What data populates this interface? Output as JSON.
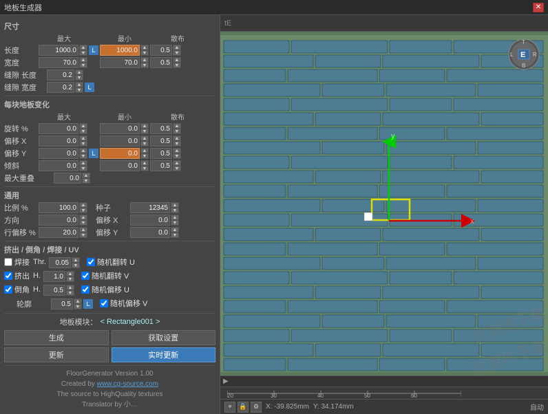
{
  "titleBar": {
    "title": "地板生成器",
    "closeIcon": "✕"
  },
  "leftPanel": {
    "sectionSize": "尺寸",
    "headers": {
      "max": "最大",
      "min": "最小",
      "scatter": "散布"
    },
    "lengthLabel": "长度",
    "lengthMax": "1000.0",
    "lengthMin": "1000.0",
    "lengthScatter": "0.5",
    "widthLabel": "宽度",
    "widthMax": "70.0",
    "widthMin": "70.0",
    "widthScatter": "0.5",
    "gapLengthLabel": "缝隙 长度",
    "gapLength": "0.2",
    "gapWidthLabel": "缝隙 宽度",
    "gapWidth": "0.2",
    "sectionTile": "每块地板变化",
    "rotateLabel": "旋转 %",
    "rotateMax": "0.0",
    "rotateMin": "0.0",
    "rotateScatter": "0.5",
    "offsetXLabel": "偏移 X",
    "offsetXMax": "0.0",
    "offsetXMin": "0.0",
    "offsetXScatter": "0.5",
    "offsetYLabel": "偏移 Y",
    "offsetYMax": "0.0",
    "offsetYMin": "0.0",
    "offsetYScatter": "0.5",
    "tiltLabel": "倾斜",
    "tiltMax": "0.0",
    "tiltMin": "0.0",
    "tiltScatter": "0.5",
    "maxOverlapLabel": "最大重叠",
    "maxOverlap": "0.0",
    "sectionGeneral": "通用",
    "scaleLabel": "比例 %",
    "scaleValue": "100.0",
    "seedLabel": "种子",
    "seedValue": "12345",
    "directionLabel": "方向",
    "directionValue": "0.0",
    "offsetXGenLabel": "偏移 X",
    "offsetXGenValue": "0.0",
    "rowOffsetLabel": "行偏移 %",
    "rowOffsetValue": "20.0",
    "offsetYGenLabel": "偏移 Y",
    "offsetYGenValue": "0.0",
    "sectionExtrude": "挤出 / 倒角 / 焊接 / UV",
    "weldLabel": "焊接",
    "weldThr": "Thr.",
    "weldThrValue": "0.05",
    "randFlipU": "随机翻转 U",
    "extrudeLabel": "挤出",
    "extrudeH": "H.",
    "extrudeHValue": "1.0",
    "randFlipV": "随机翻转 V",
    "chamferLabel": "倒角",
    "chamferH": "H.",
    "chamferHValue": "0.5",
    "randOffsetU": "随机偏移 U",
    "outlineLabel": "轮廓",
    "outlineValue": "0.5",
    "randOffsetV": "随机偏移 V",
    "floorModuleLabel": "地板模块：",
    "floorModuleValue": "< Rectangle001 >",
    "generateBtn": "生成",
    "getSettingsBtn": "获取设置",
    "updateBtn": "更新",
    "realtimeBtn": "实时更新",
    "version": "FloorGenerator Version 1.00",
    "createdBy": "Created by",
    "websiteUrl": "www.cg-source.com",
    "sourceText": "The source to HighQuality textures",
    "translatorLabel": "Translator by 小…"
  },
  "viewport": {
    "expandIcon": "▶",
    "coordX": "X: -39.825mm",
    "coordY": "Y: 34.174mm",
    "autoText": "自动",
    "scaleMarkers": [
      "20",
      "30",
      "40",
      "50",
      "60"
    ]
  },
  "watermark": {
    "line1": "比克尔下载",
    "line2": "www.bkill.com",
    "line3": "比克尔下载"
  }
}
